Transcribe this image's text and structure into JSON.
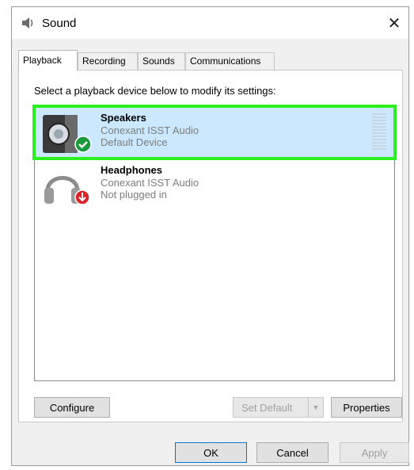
{
  "window": {
    "title": "Sound",
    "close_glyph": "✕",
    "title_icon": "speaker-icon"
  },
  "tabs": [
    {
      "label": "Playback",
      "active": true
    },
    {
      "label": "Recording",
      "active": false
    },
    {
      "label": "Sounds",
      "active": false
    },
    {
      "label": "Communications",
      "active": false
    }
  ],
  "playback": {
    "instruction": "Select a playback device below to modify its settings:",
    "devices": [
      {
        "name": "Speakers",
        "driver": "Conexant ISST Audio",
        "status": "Default Device",
        "icon": "speakers-icon",
        "status_icon": "default-check-icon",
        "selected": true
      },
      {
        "name": "Headphones",
        "driver": "Conexant ISST Audio",
        "status": "Not plugged in",
        "icon": "headphones-icon",
        "status_icon": "unplugged-arrow-icon",
        "selected": false
      }
    ],
    "buttons": {
      "configure": "Configure",
      "set_default": "Set Default",
      "properties": "Properties"
    }
  },
  "footer": {
    "ok": "OK",
    "cancel": "Cancel",
    "apply": "Apply"
  },
  "colors": {
    "selection_bg": "#cce8ff",
    "highlight_outline": "#2cf01e",
    "check_badge": "#1a9a3c",
    "unplugged_badge": "#d9252a"
  }
}
